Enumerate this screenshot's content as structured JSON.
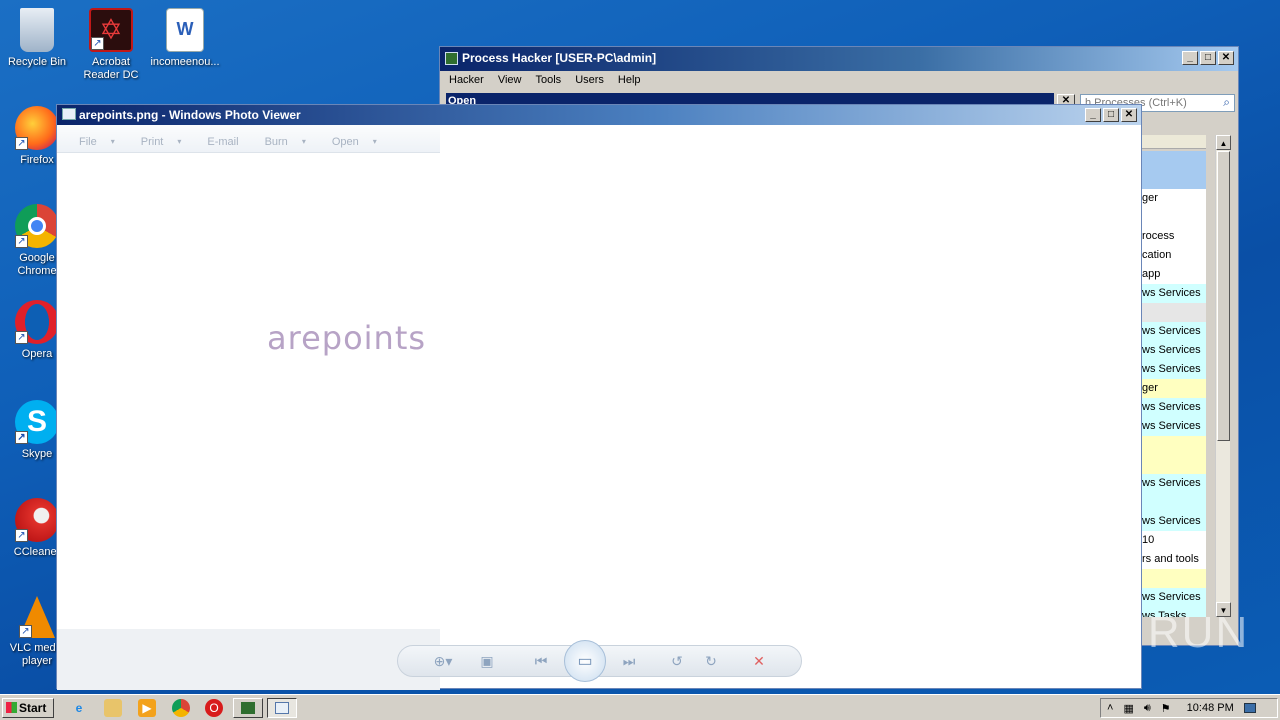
{
  "desktop": {
    "icons": [
      {
        "label": "Recycle Bin"
      },
      {
        "label": "Acrobat Reader DC"
      },
      {
        "label": "incomeenou..."
      },
      {
        "label": "Firefox"
      },
      {
        "label": "Google Chrome"
      },
      {
        "label": "Opera"
      },
      {
        "label": "Skype"
      },
      {
        "label": "CCleaner"
      },
      {
        "label": "VLC media player"
      }
    ]
  },
  "process_hacker": {
    "title": "Process Hacker [USER-PC\\admin]",
    "menu": [
      "Hacker",
      "View",
      "Tools",
      "Users",
      "Help"
    ],
    "open_label": "Open",
    "search_placeholder": "h Processes (Ctrl+K)",
    "rows": [
      {
        "text": "",
        "color": "#a6caf0"
      },
      {
        "text": "",
        "color": "#a6caf0"
      },
      {
        "text": "ger",
        "color": "#ffffff"
      },
      {
        "text": "",
        "color": "#ffffff"
      },
      {
        "text": "rocess",
        "color": "#ffffff"
      },
      {
        "text": "cation",
        "color": "#ffffff"
      },
      {
        "text": "app",
        "color": "#ffffff"
      },
      {
        "text": "ws Services",
        "color": "#d0ffff"
      },
      {
        "text": "",
        "color": "#e6e6e6"
      },
      {
        "text": "ws Services",
        "color": "#d0ffff"
      },
      {
        "text": "ws Services",
        "color": "#d0ffff"
      },
      {
        "text": "ws Services",
        "color": "#d0ffff"
      },
      {
        "text": "ger",
        "color": "#ffffc0"
      },
      {
        "text": "ws Services",
        "color": "#d0ffff"
      },
      {
        "text": "ws Services",
        "color": "#d0ffff"
      },
      {
        "text": "",
        "color": "#ffffc0"
      },
      {
        "text": "",
        "color": "#ffffc0"
      },
      {
        "text": "ws Services",
        "color": "#d0ffff"
      },
      {
        "text": "",
        "color": "#d0ffff"
      },
      {
        "text": "ws Services",
        "color": "#d0ffff"
      },
      {
        "text": "10",
        "color": "#ffffff"
      },
      {
        "text": "rs and tools",
        "color": "#ffffff"
      },
      {
        "text": "",
        "color": "#ffffc0"
      },
      {
        "text": "ws Services",
        "color": "#d0ffff"
      },
      {
        "text": "ws Tasks",
        "color": "#d0ffff"
      }
    ]
  },
  "photo_viewer": {
    "title": "arepoints.png - Windows Photo Viewer",
    "toolbar": {
      "file": "File",
      "print": "Print",
      "email": "E-mail",
      "burn": "Burn",
      "open": "Open"
    },
    "image_text": "arepoints"
  },
  "taskbar": {
    "start_label": "Start",
    "clock": "10:48 PM"
  },
  "watermark": "ANY RUN"
}
